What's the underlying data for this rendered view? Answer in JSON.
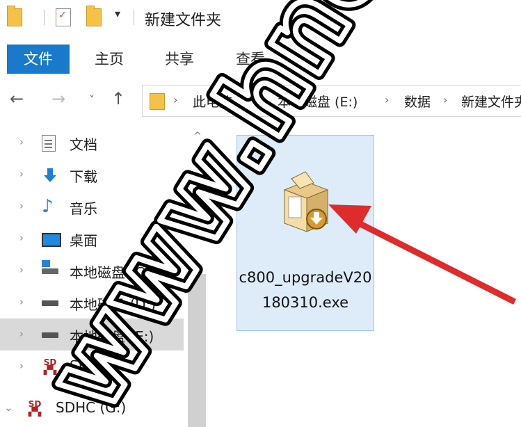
{
  "window": {
    "title": "新建文件夹",
    "qat_dropdown_glyph": "▾"
  },
  "ribbon": {
    "tabs": [
      {
        "label": "文件",
        "active": true
      },
      {
        "label": "主页"
      },
      {
        "label": "共享"
      },
      {
        "label": "查看"
      }
    ],
    "accent_color": "#1979ca"
  },
  "navigation": {
    "back_glyph": "←",
    "forward_glyph": "→",
    "recent_glyph": "˅",
    "up_glyph": "↑",
    "breadcrumb": [
      "此电脑",
      "本地磁盘 (E:)",
      "数据",
      "新建文件夹"
    ],
    "separator": "›"
  },
  "sidebar": {
    "items": [
      {
        "label": "文档",
        "icon": "document-icon",
        "expander": "›"
      },
      {
        "label": "下载",
        "icon": "download-icon",
        "expander": "›"
      },
      {
        "label": "音乐",
        "icon": "music-icon",
        "expander": "›"
      },
      {
        "label": "桌面",
        "icon": "desktop-icon",
        "expander": "›"
      },
      {
        "label": "本地磁盘 (C:)",
        "icon": "system-drive-icon",
        "expander": "›"
      },
      {
        "label": "本地磁盘 (D:)",
        "icon": "drive-icon",
        "expander": "›"
      },
      {
        "label": "本地磁盘 (E:)",
        "icon": "drive-icon",
        "expander": "›",
        "selected": true
      },
      {
        "label": "SDHC (G:)",
        "icon": "sd-card-icon",
        "expander": "›"
      },
      {
        "label": "SDHC (G:)",
        "icon": "sd-card-icon",
        "expander": "⌄"
      }
    ],
    "scroll_up_glyph": "^"
  },
  "files": [
    {
      "name": "c800_upgradeV20180310.exe",
      "icon": "installer-package-icon",
      "selected": true
    }
  ],
  "overlay": {
    "watermark_text": "www.hnobd.",
    "arrow_color": "#e02b2b"
  }
}
